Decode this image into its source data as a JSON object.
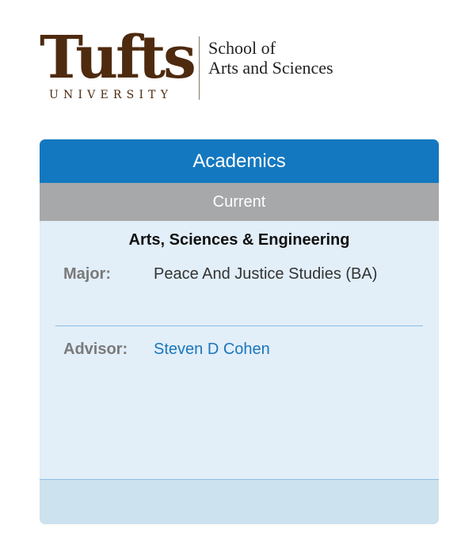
{
  "logo": {
    "wordmark": "Tufts",
    "subtitle": "UNIVERSITY",
    "school_line1": "School of",
    "school_line2": "Arts and Sciences"
  },
  "panel": {
    "title": "Academics",
    "subtitle": "Current",
    "school": "Arts, Sciences & Engineering",
    "major_label": "Major:",
    "major_value": "Peace And Justice Studies (BA)",
    "advisor_label": "Advisor:",
    "advisor_value": "Steven D Cohen"
  },
  "colors": {
    "header_blue": "#1478c0",
    "subheader_gray": "#a6a8aa",
    "panel_bg": "#e2eef8",
    "link_blue": "#1a76bc",
    "logo_brown": "#4e2a0f"
  }
}
